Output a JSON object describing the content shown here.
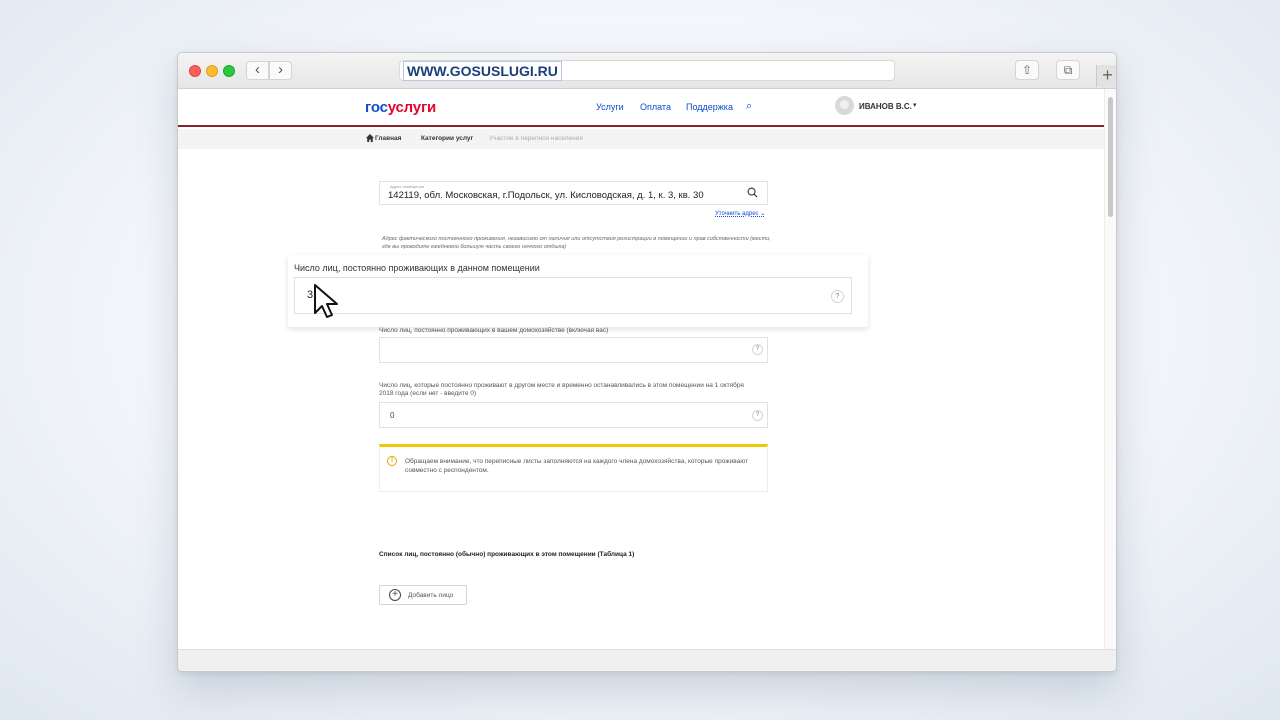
{
  "browser": {
    "url": "WWW.GOSUSLUGI.RU",
    "back_icon": "‹",
    "forward_icon": "›",
    "share_icon": "⇧",
    "tabs_icon": "⧉",
    "new_tab_icon": "+"
  },
  "header": {
    "logo_part1": "гос",
    "logo_part2": "услуги",
    "nav": [
      "Услуги",
      "Оплата",
      "Поддержка"
    ],
    "search_icon": "⌕",
    "user_name": "ИВАНОВ В.С.",
    "user_caret": "▾"
  },
  "breadcrumb": {
    "home": "Главная",
    "category": "Категории услуг",
    "current": "Участие в переписи населения"
  },
  "form": {
    "address_label": "Адрес помещения",
    "address_value": "142119, обл. Московская, г.Подольск, ул. Кисловодская, д. 1, к. 3, кв. 30",
    "clarify_link": "Уточнить адрес ⌄",
    "address_hint": "Адрес фактического постоянного проживания, независимо от наличия или отсутствия регистрации в помещении и прав собственности (место, где вы проводите ежедневно большую часть своего ночного отдыха)",
    "residents_label": "Число лиц, постоянно проживающих в данном помещении",
    "residents_value": "3",
    "household_label": "Число лиц, постоянно проживающих в вашем домохозяйстве (включая вас)",
    "household_value": "",
    "temporary_label": "Число лиц, которые постоянно проживают в другом месте и временно останавливались в этом помещении на 1 октября 2018 года (если нет - введите 0)",
    "temporary_value": "0",
    "help_mark": "?",
    "notice_icon": "!",
    "notice_text": "Обращаем внимание, что переписные листы заполняются на каждого члена домохозяйства, которые проживают совместно с респондентом.",
    "table_title": "Список лиц, постоянно (обычно) проживающих в этом помещении (Таблица 1)",
    "add_button_icon": "+",
    "add_button": "Добавить лицо"
  },
  "colors": {
    "brand_blue": "#0d4cd3",
    "brand_red": "#e3062f",
    "header_line": "#8a1e2c",
    "notice_accent": "#f2c800"
  }
}
